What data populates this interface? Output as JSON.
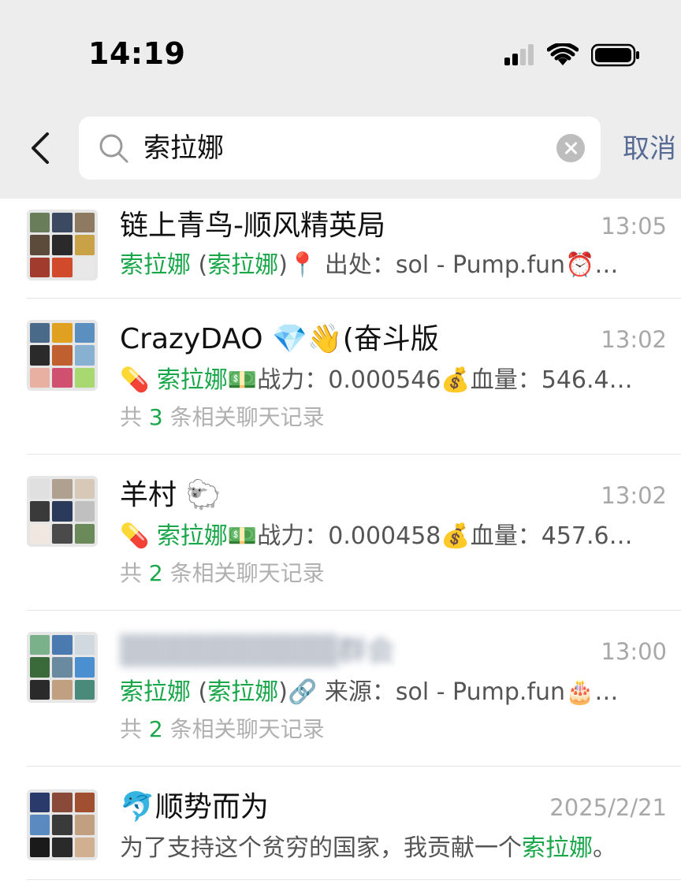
{
  "status_bar": {
    "time": "14:19"
  },
  "search": {
    "query": "索拉娜",
    "cancel_label": "取消"
  },
  "results": [
    {
      "title": "链上青鸟-顺风精英局",
      "time": "13:05",
      "snippet_hl1": "索拉娜",
      "snippet_mid": " (",
      "snippet_hl2": "索拉娜",
      "snippet_rest": ")📍 出处：sol - Pump.fun⏰…",
      "avatar_colors": [
        "#6a7d5a",
        "#3b4a60",
        "#8d7a60",
        "#5c4a3a",
        "#2a2a2a",
        "#c9a248",
        "#a13b2d",
        "#d24a2c",
        "#e8e8e8"
      ]
    },
    {
      "title": "CrazyDAO 💎👋(奋斗版",
      "time": "13:02",
      "snippet_prefix": "💊 ",
      "snippet_hl1": "索拉娜",
      "snippet_rest": "💵战力：0.000546💰血量：546.4…",
      "count_prefix": "共 ",
      "count_num": "3",
      "count_suffix": " 条相关聊天记录",
      "avatar_colors": [
        "#4a6a8a",
        "#e0a020",
        "#5b8fc0",
        "#2a2a2a",
        "#c06030",
        "#88b0d0",
        "#e8b0a0",
        "#d05070",
        "#a8d870"
      ]
    },
    {
      "title": "羊村 🐑",
      "time": "13:02",
      "snippet_prefix": "💊 ",
      "snippet_hl1": "索拉娜",
      "snippet_rest": "💵战力：0.000458💰血量：457.6…",
      "count_prefix": "共 ",
      "count_num": "2",
      "count_suffix": " 条相关聊天记录",
      "avatar_colors": [
        "#e0e0e0",
        "#b0a090",
        "#d8c8b8",
        "#3a3a3a",
        "#2a3a5a",
        "#c0c0c0",
        "#f0e8e0",
        "#4a4a4a",
        "#6a8a5a"
      ]
    },
    {
      "title": "▒▒▒▒▒▒▒▒▒▒群会",
      "time": "13:00",
      "snippet_hl1": "索拉娜",
      "snippet_mid": " (",
      "snippet_hl2": "索拉娜",
      "snippet_rest": ")🔗 来源：sol - Pump.fun🎂…",
      "count_prefix": "共 ",
      "count_num": "2",
      "count_suffix": " 条相关聊天记录",
      "avatar_colors": [
        "#7ab08a",
        "#4a7ab0",
        "#d0d8e0",
        "#3a6a3a",
        "#6a8aa0",
        "#4a90d0",
        "#2a2a2a",
        "#c0a080",
        "#4a8a7a"
      ]
    },
    {
      "title": "🐬顺势而为",
      "time": "2025/2/21",
      "snippet_plain": "为了支持这个贫穷的国家，我贡献一个",
      "snippet_hl1": "索拉娜",
      "snippet_rest": "。",
      "avatar_colors": [
        "#2a3a6a",
        "#8a4a3a",
        "#a05030",
        "#5a8ac0",
        "#3a3a3a",
        "#c0a080",
        "#1a1a1a",
        "#2a2a2a",
        "#d0b090"
      ]
    }
  ]
}
